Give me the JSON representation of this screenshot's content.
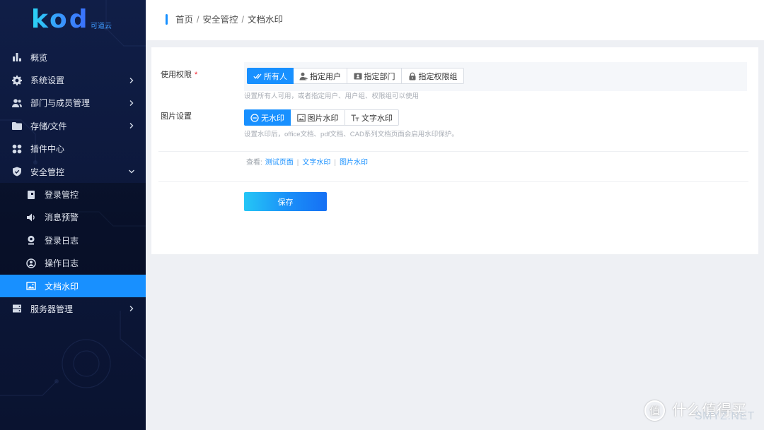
{
  "colors": {
    "accent": "#1890ff",
    "sidebar_bg": "#0c1739",
    "required_mark": "#f5222d",
    "link": "#1890ff",
    "save_gradient": [
      "#25c6f6",
      "#1670f4"
    ]
  },
  "brand": {
    "logo": "kod",
    "name": "可道云"
  },
  "sidebar": {
    "items": [
      {
        "label": "概览",
        "icon": "bar-chart-icon"
      },
      {
        "label": "系统设置",
        "icon": "gear-icon",
        "expandable": true
      },
      {
        "label": "部门与成员管理",
        "icon": "users-icon",
        "expandable": true
      },
      {
        "label": "存储/文件",
        "icon": "folder-icon",
        "expandable": true
      },
      {
        "label": "插件中心",
        "icon": "plugin-grid-icon"
      },
      {
        "label": "安全管控",
        "icon": "shield-icon",
        "expanded": true,
        "children": [
          {
            "label": "登录管控",
            "icon": "door-icon"
          },
          {
            "label": "消息预警",
            "icon": "speaker-icon"
          },
          {
            "label": "登录日志",
            "icon": "lightbulb-icon"
          },
          {
            "label": "操作日志",
            "icon": "user-circle-icon"
          },
          {
            "label": "文档水印",
            "icon": "image-icon",
            "active": true
          }
        ]
      },
      {
        "label": "服务器管理",
        "icon": "server-icon",
        "expandable": true
      }
    ]
  },
  "breadcrumb": {
    "items": [
      "首页",
      "安全管控",
      "文档水印"
    ],
    "separator": "/"
  },
  "form": {
    "permission": {
      "label": "使用权限",
      "required_mark": "*",
      "options": [
        {
          "label": "所有人",
          "icon": "double-check-icon",
          "selected": true
        },
        {
          "label": "指定用户",
          "icon": "user-plus-icon",
          "selected": false
        },
        {
          "label": "指定部门",
          "icon": "id-card-icon",
          "selected": false
        },
        {
          "label": "指定权限组",
          "icon": "lock-icon",
          "selected": false
        }
      ],
      "help": "设置所有人可用，或者指定用户、用户组、权限组可以使用"
    },
    "watermark": {
      "label": "图片设置",
      "options": [
        {
          "label": "无水印",
          "icon": "minus-circle-icon",
          "selected": true
        },
        {
          "label": "图片水印",
          "icon": "image-icon",
          "selected": false
        },
        {
          "label": "文字水印",
          "icon": "text-icon",
          "selected": false
        }
      ],
      "help": "设置水印后，office文档、pdf文档、CAD系列文档页面会启用水印保护。"
    },
    "preview": {
      "label": "查看:",
      "separator": "|",
      "links": [
        "测试页面",
        "文字水印",
        "图片水印"
      ]
    },
    "save_label": "保存"
  },
  "overlay_watermark": {
    "badge": "值",
    "brand": "什么值得买",
    "site": "SMYZ.NET"
  }
}
